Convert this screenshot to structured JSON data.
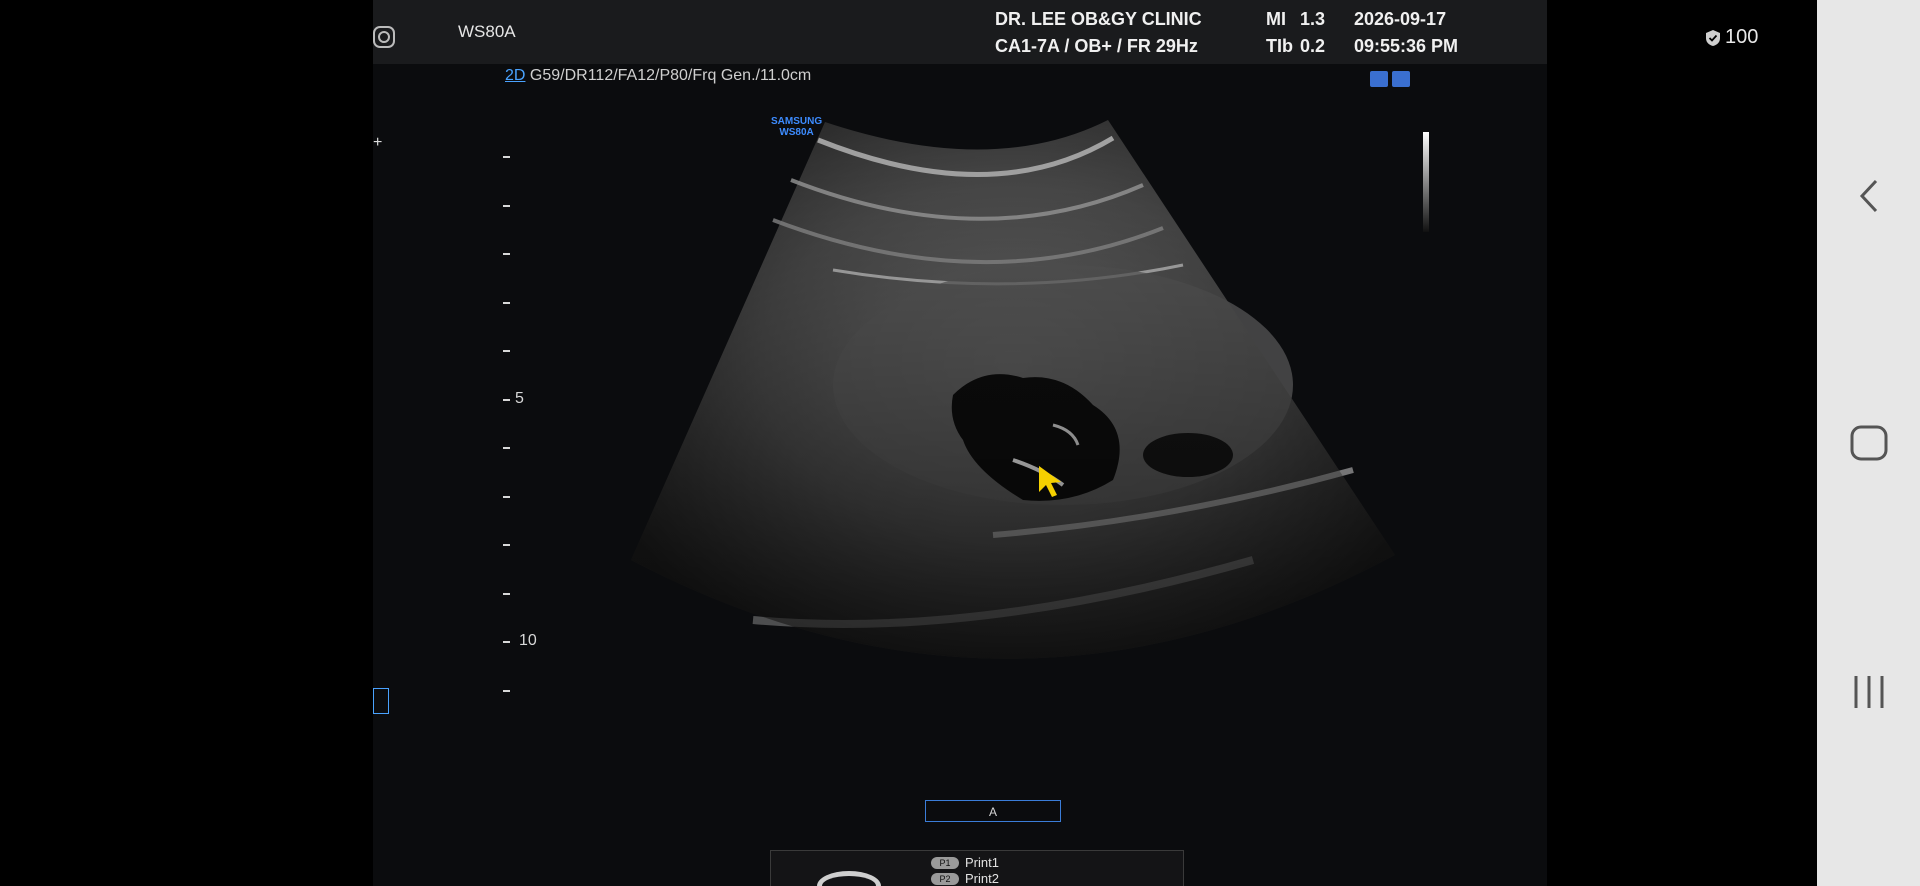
{
  "header": {
    "device_model": "WS80A",
    "clinic": "DR. LEE OB&GY CLINIC",
    "probe_info": "CA1-7A / OB+ / FR 29Hz",
    "mi_label": "MI",
    "mi_value": "1.3",
    "tib_label": "TIb",
    "tib_value": "0.2",
    "date": "2026-09-17",
    "time": "09:55:36 PM"
  },
  "image_params": {
    "mode": "2D",
    "settings": "G59/DR112/FA12/P80/Frq Gen./11.0cm"
  },
  "badge": {
    "brand": "SAMSUNG",
    "model": "WS80A"
  },
  "depth_scale": {
    "labels": [
      {
        "value": "5",
        "tick_index": 5
      },
      {
        "value": "10",
        "tick_index": 10
      }
    ],
    "tick_count": 12
  },
  "annotation": {
    "label": "A"
  },
  "print_panel": {
    "items": [
      {
        "key": "P1",
        "label": "Print1"
      },
      {
        "key": "P2",
        "label": "Print2"
      }
    ]
  },
  "status_bar": {
    "battery": "100"
  },
  "icons": {
    "nav": [
      "back-icon",
      "home-icon",
      "recent-apps-icon"
    ],
    "misc": [
      "instagram-icon",
      "shield-icon",
      "cursor-icon"
    ]
  },
  "colors": {
    "accent_blue": "#3d8cff",
    "cursor_yellow": "#f5d000",
    "nav_bg": "#e7e7e7"
  }
}
